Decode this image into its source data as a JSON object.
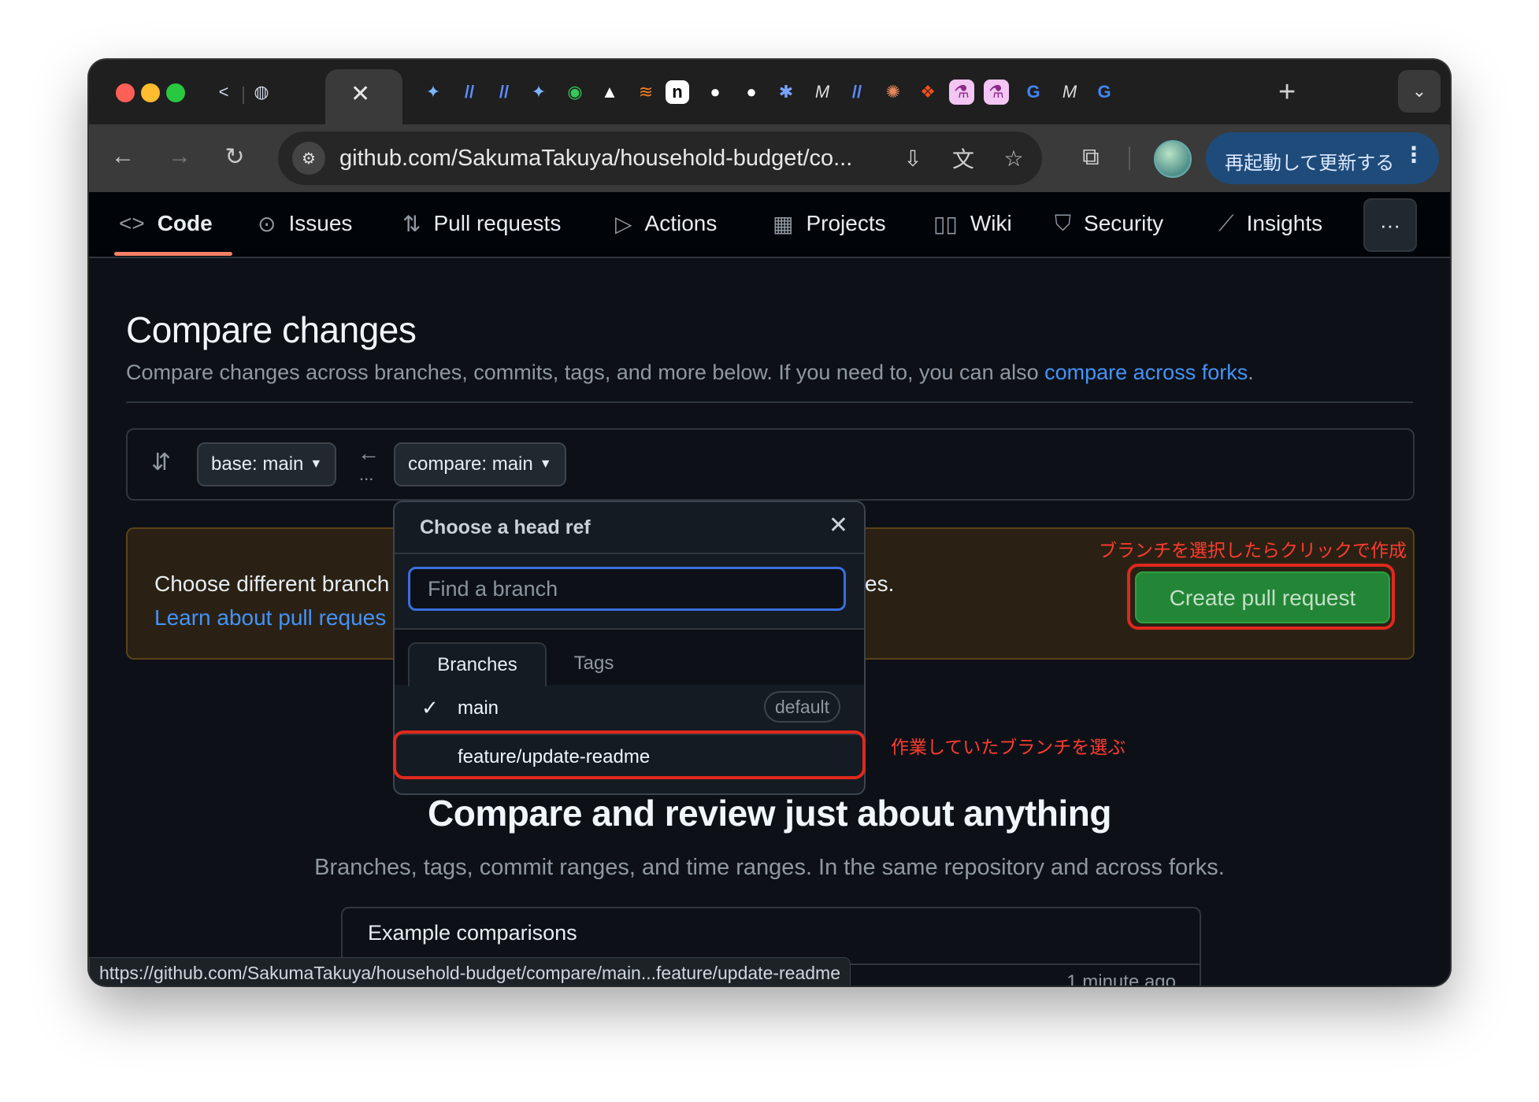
{
  "browser": {
    "active_tab_close": "✕",
    "new_tab": "+",
    "url": "github.com/SakumaTakuya/household-budget/co...",
    "update_button": "再起動して更新する",
    "status_url": "https://github.com/SakumaTakuya/household-budget/compare/main...feature/update-readme"
  },
  "repo_nav": {
    "items": [
      "Code",
      "Issues",
      "Pull requests",
      "Actions",
      "Projects",
      "Wiki",
      "Security",
      "Insights"
    ],
    "active": "Code"
  },
  "page": {
    "title": "Compare changes",
    "subtitle": "Compare changes across branches, commits, tags, and more below. If you need to, you can also ",
    "subtitle_link": "compare across forks",
    "subtitle_end": "."
  },
  "range": {
    "base": "base: main",
    "compare": "compare: main",
    "dots": "..."
  },
  "flash": {
    "text": "Choose different branch",
    "text_end": "es.",
    "link": "Learn about pull reques"
  },
  "create_pr": {
    "label": "Create pull request",
    "annotation": "ブランチを選択したらクリックで作成"
  },
  "dropdown": {
    "title": "Choose a head ref",
    "placeholder": "Find a branch",
    "tabs": [
      "Branches",
      "Tags"
    ],
    "branches": [
      {
        "name": "main",
        "badge": "default",
        "selected": true
      },
      {
        "name": "feature/update-readme",
        "badge": "",
        "selected": false
      }
    ],
    "annotation": "作業していたブランチを選ぶ"
  },
  "blankslate": {
    "title": "Compare and review just about anything",
    "subtitle": "Branches, tags, commit ranges, and time ranges. In the same repository and across forks.",
    "examples_title": "Example comparisons",
    "time": "1 minute ago"
  },
  "colors": {
    "accent_link": "#4493f8",
    "create_button": "#238636",
    "annotation_red": "#e0291d",
    "tab_underline": "#f78166"
  }
}
